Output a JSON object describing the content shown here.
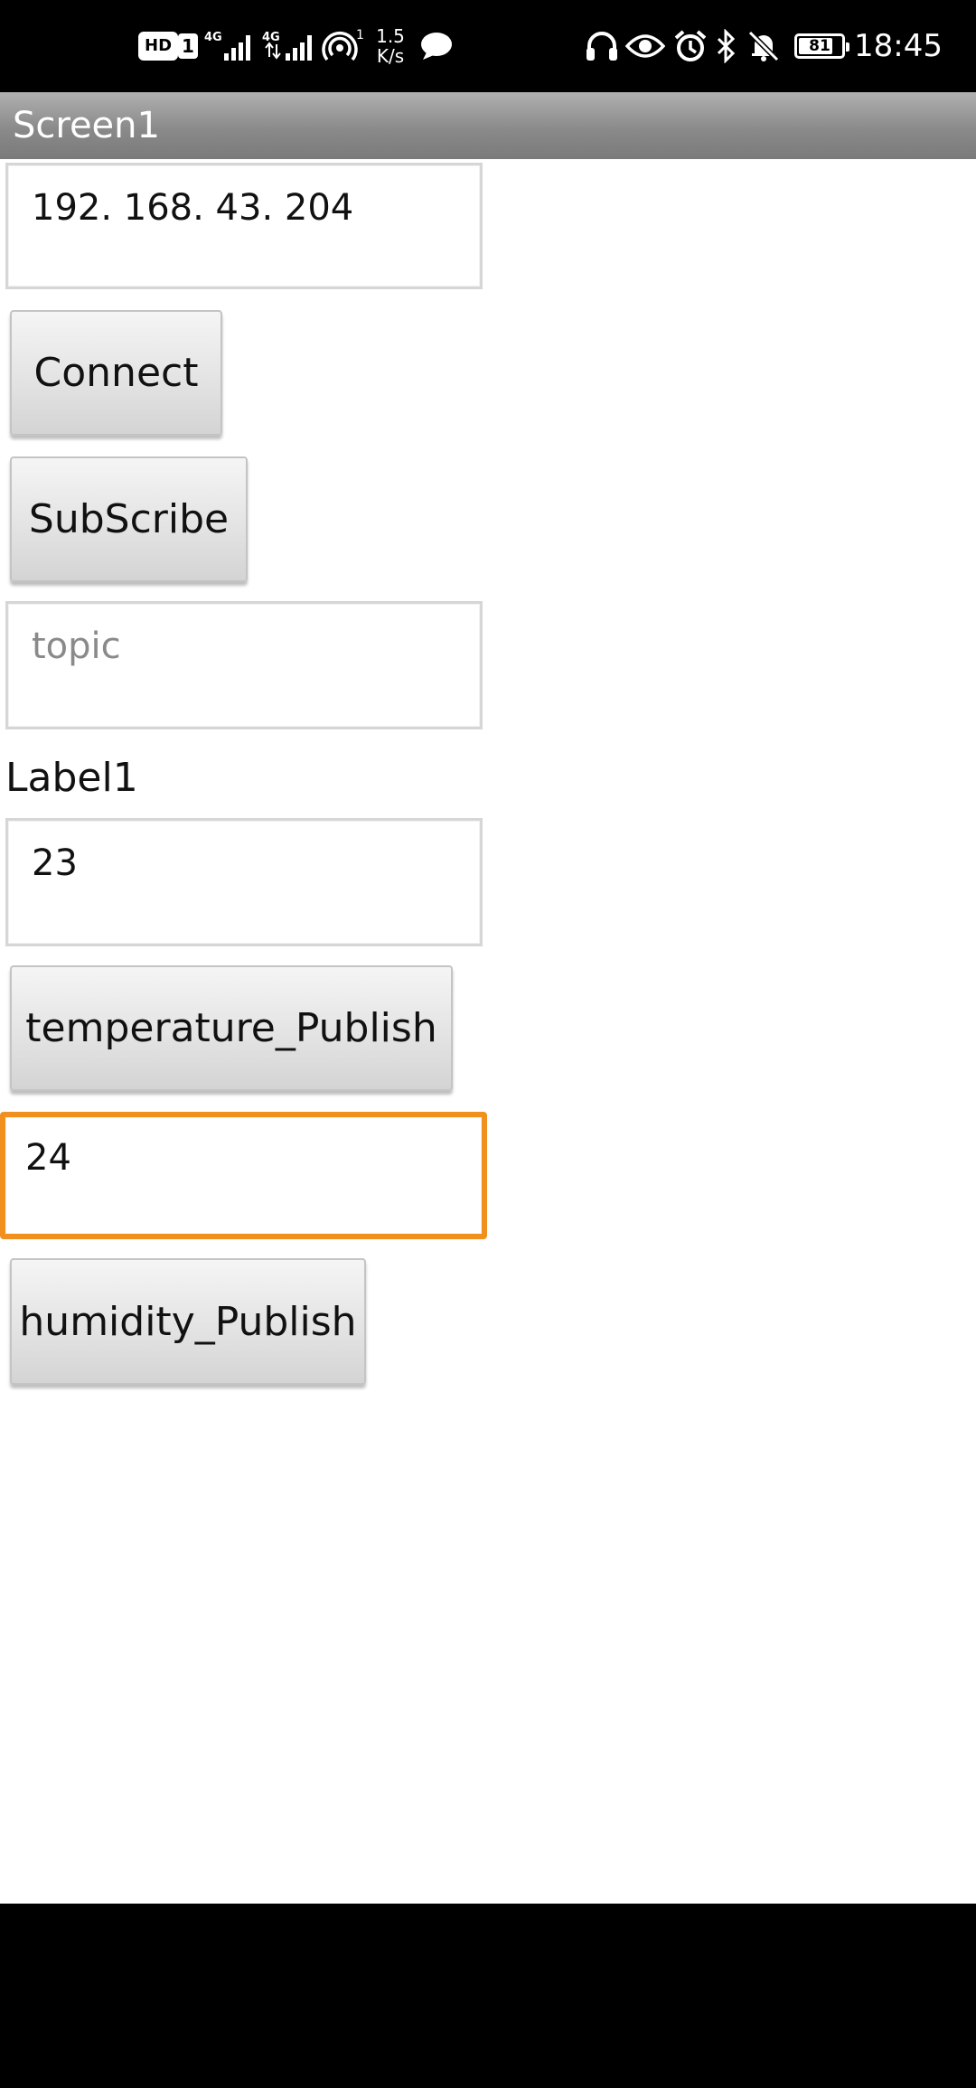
{
  "status_bar": {
    "hd_label": "HD",
    "sim_label": "1",
    "network_1": "4G",
    "network_2": "4G",
    "hotspot_count": "1",
    "net_speed_value": "1.5",
    "net_speed_unit": "K/s",
    "battery_level": "81",
    "battery_fraction": 0.81,
    "time": "18:45",
    "icons": [
      "signal-icon",
      "hotspot-icon",
      "message-icon",
      "headphones-icon",
      "eye-icon",
      "alarm-icon",
      "bluetooth-icon",
      "mute-icon",
      "battery-icon"
    ]
  },
  "app": {
    "title": "Screen1",
    "title_bar_color": "#8a8a8a"
  },
  "form": {
    "ip_field_value": "192. 168. 43. 204",
    "connect_label": "Connect",
    "subscribe_label": "SubScribe",
    "topic_placeholder": "topic",
    "label1_text": "Label1",
    "temperature_value": "23",
    "temperature_publish_label": "temperature_Publish",
    "humidity_value": "24",
    "humidity_publish_label": "humidity_Publish",
    "focus_color": "#f0901e"
  }
}
